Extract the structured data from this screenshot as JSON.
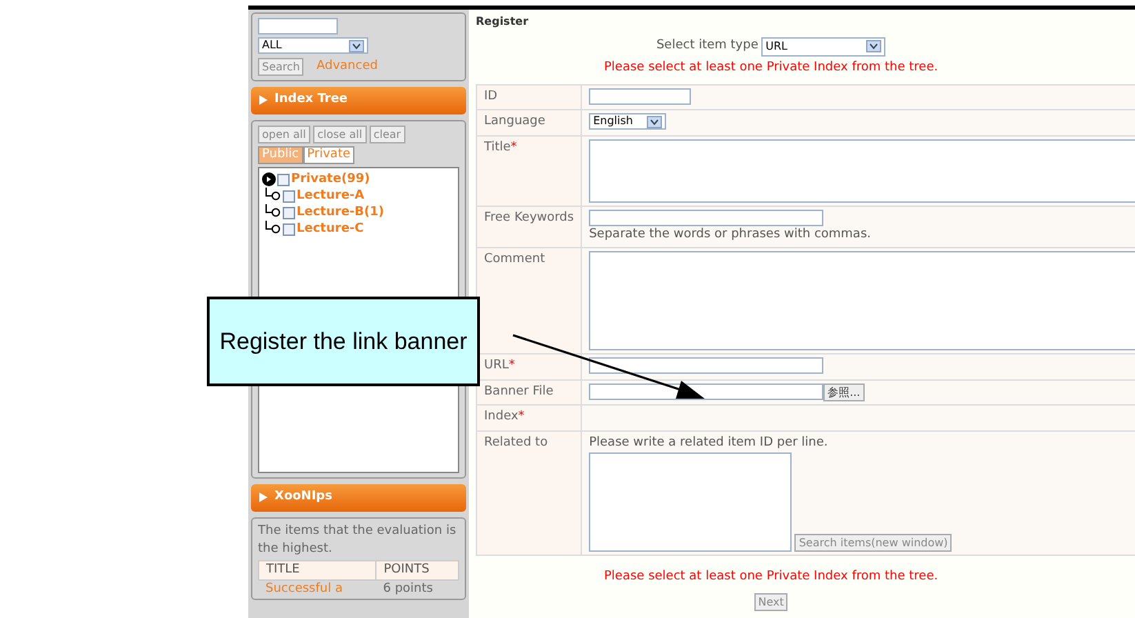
{
  "sidebar": {
    "search": {
      "scope": "ALL",
      "button": "Search",
      "advanced_link": "Advanced"
    },
    "index_tree": {
      "title": "Index Tree",
      "buttons": [
        "open all",
        "close all",
        "clear"
      ],
      "tabs": [
        {
          "label": "Public",
          "selected": false
        },
        {
          "label": "Private",
          "selected": true
        }
      ],
      "tree": [
        {
          "label": "Private(99)",
          "checked": false,
          "expanded": true,
          "children": [
            {
              "label": "Lecture-A",
              "checked": false
            },
            {
              "label": "Lecture-B(1)",
              "checked": false
            },
            {
              "label": "Lecture-C",
              "checked": false
            }
          ]
        }
      ]
    },
    "xoonips": {
      "title": "XooNIps",
      "description": "The items that the evaluation is the highest.",
      "columns": [
        "TITLE",
        "POINTS"
      ],
      "rows": [
        [
          "Successful a",
          "6 points"
        ]
      ]
    }
  },
  "main": {
    "title": "Register",
    "required_mark": "*",
    "item_type": {
      "label": "Select item type",
      "value": "URL"
    },
    "error": "Please select at least one Private Index from the tree.",
    "fields": [
      {
        "label": "ID",
        "required": false,
        "kind": "short-text"
      },
      {
        "label": "Language",
        "required": false,
        "kind": "select",
        "value": "English"
      },
      {
        "label": "Title",
        "required": true,
        "kind": "textarea"
      },
      {
        "label": "Free Keywords",
        "required": false,
        "kind": "text",
        "hint": "Separate the words or phrases with commas."
      },
      {
        "label": "Comment",
        "required": false,
        "kind": "tall-textarea"
      },
      {
        "label": "URL",
        "required": true,
        "kind": "text"
      },
      {
        "label": "Banner File",
        "required": false,
        "kind": "file",
        "button": "参照..."
      },
      {
        "label": "Index",
        "required": true,
        "kind": "none"
      },
      {
        "label": "Related to",
        "required": false,
        "kind": "related",
        "hint": "Please write a related item ID per line.",
        "button": "Search items(new window)"
      }
    ],
    "error_bottom": "Please select at least one Private Index from the tree.",
    "next_button": "Next"
  },
  "callout": {
    "text": "Register the link banner"
  }
}
